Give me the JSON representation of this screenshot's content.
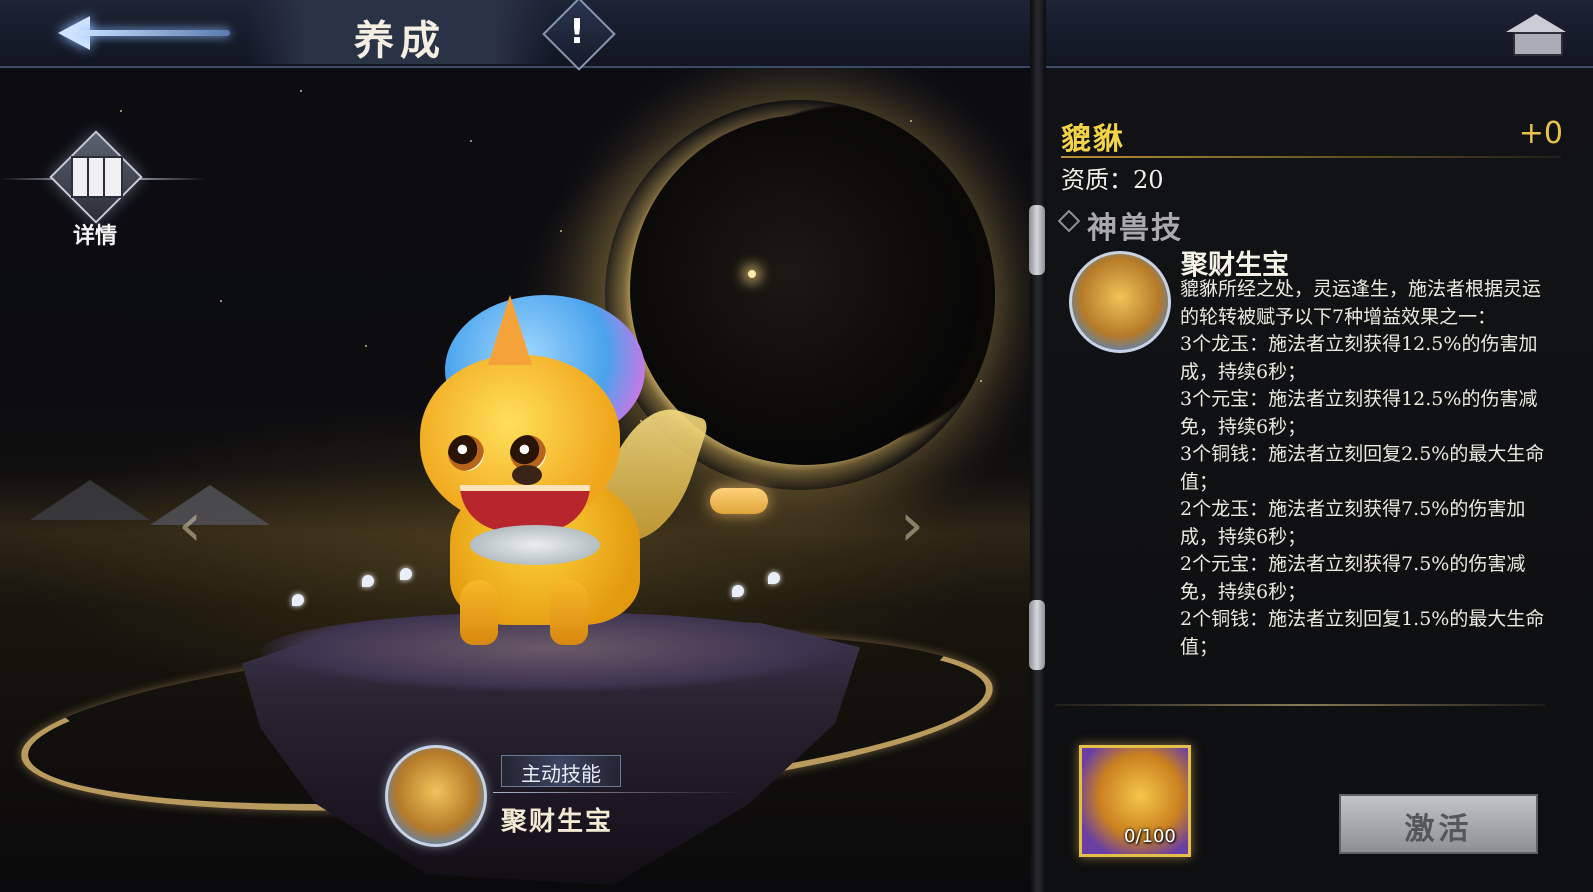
{
  "header": {
    "title": "养成",
    "alert_glyph": "!"
  },
  "left": {
    "detail_label": "详情",
    "active_skill": {
      "tag": "主动技能",
      "name": "聚财生宝"
    }
  },
  "panel": {
    "beast_name": "貔貅",
    "level": "+0",
    "quality": "资质：20",
    "section_title": "神兽技",
    "skill": {
      "name": "聚财生宝",
      "description": "貔貅所经之处，灵运逢生，施法者根据灵运的轮转被赋予以下7种增益效果之一：\n3个龙玉：施法者立刻获得12.5%的伤害加成，持续6秒；\n3个元宝：施法者立刻获得12.5%的伤害减免，持续6秒；\n3个铜钱：施法者立刻回复2.5%的最大生命值；\n2个龙玉：施法者立刻获得7.5%的伤害加成，持续6秒；\n2个元宝：施法者立刻获得7.5%的伤害减免，持续6秒；\n2个铜钱：施法者立刻回复1.5%的最大生命值；"
    },
    "shard_count": "0/100",
    "activate_label": "激活"
  },
  "icons": {
    "back": "back-arrow-icon",
    "alert": "exclamation-icon",
    "detail": "book-icon",
    "home": "pavilion-icon",
    "section": "diamond-icon"
  },
  "colors": {
    "name_gold": "#f3d348",
    "topbar": "#1d2434",
    "button_disabled": "#a9abb0"
  }
}
